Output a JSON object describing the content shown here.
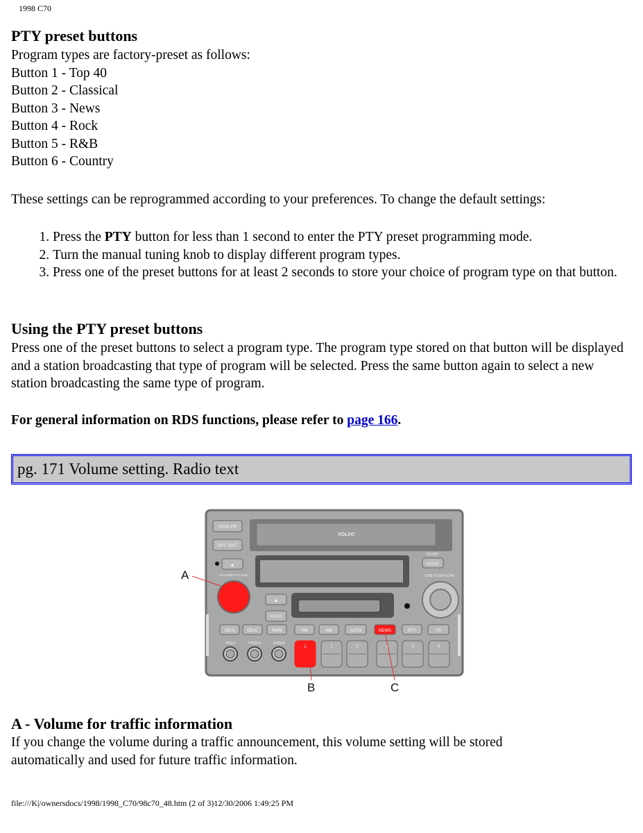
{
  "header": "1998 C70",
  "section1": {
    "title": "PTY preset buttons",
    "intro": "Program types are factory-preset as follows:",
    "presets": [
      "Button 1 - Top 40",
      "Button 2 - Classical",
      "Button 3 - News",
      "Button 4 - Rock",
      "Button 5 - R&B",
      "Button 6 - Country"
    ],
    "para": "These settings can be reprogrammed according to your preferences. To change the default settings:",
    "steps": [
      {
        "pre": "Press the ",
        "bold": "PTY",
        "post": " button for less than 1 second to enter the PTY preset programming mode."
      },
      {
        "pre": "Turn the manual tuning knob to display different program types.",
        "bold": "",
        "post": ""
      },
      {
        "pre": "Press one of the preset buttons for at least 2 seconds to store your choice of program type on that button.",
        "bold": "",
        "post": ""
      }
    ]
  },
  "section2": {
    "title": "Using the PTY preset buttons",
    "para": "Press one of the preset buttons to select a program type. The program type stored on that button will be displayed and a station broadcasting that type of program will be selected. Press the same button again to select a new station broadcasting the same type of program.",
    "note_pre": "For general information on RDS functions, please refer to ",
    "note_link": "page 166",
    "note_post": "."
  },
  "page_box": "pg. 171 Volume setting. Radio text",
  "figure": {
    "callouts": [
      "A",
      "B",
      "C"
    ],
    "brand": "VOLVO",
    "buttons": {
      "rew_ff": "REW FF",
      "rpt_nxt": "RPT NXT",
      "sound": "SOUND",
      "mode": "MODE",
      "tune": "TUNE PUSH/SCAN",
      "volume": "VOLUME PULL/UNL",
      "prog": "PROG",
      "row": [
        "CD-3",
        "CD-C",
        "TAPE",
        "FM",
        "AM",
        "AUTO",
        "NEWS",
        "PTY",
        "TP"
      ],
      "knobs": [
        "BASS",
        "TREBLE",
        "FADER"
      ],
      "presets": [
        "1",
        "2",
        "3",
        "4",
        "5",
        "6"
      ]
    },
    "highlight_color": "#ff1a1a"
  },
  "section3": {
    "title": "A - Volume for traffic information",
    "para": "If you change the volume during a traffic announcement, this volume setting will be stored automatically and used for future traffic information."
  },
  "footer": "file:///K|/ownersdocs/1998/1998_C70/98c70_48.htm (2 of 3)12/30/2006 1:49:25 PM"
}
